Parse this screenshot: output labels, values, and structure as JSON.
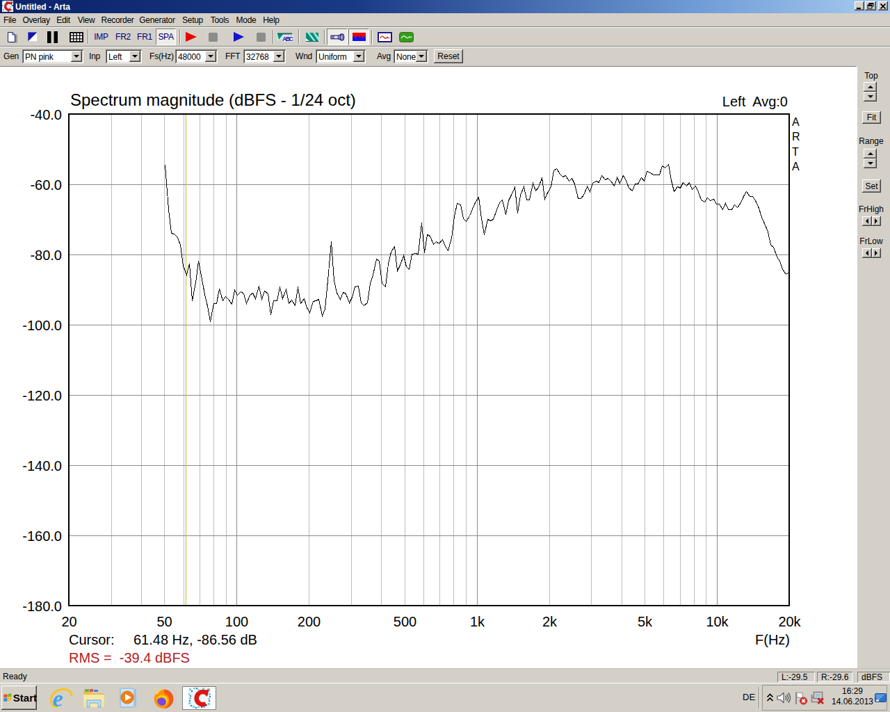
{
  "window": {
    "title": "Untitled - Arta"
  },
  "colors": {
    "titlebar_left": "#0b2369",
    "titlebar_right": "#a8cbf0",
    "ui_face": "#d4d0c8",
    "toolbar_text": "#000080",
    "rms_text": "#b22222"
  },
  "icons": [
    "app-icon",
    "minimize-icon",
    "restore-icon",
    "close-icon",
    "new-file-icon",
    "overlay-icon",
    "pause-icon",
    "table-icon",
    "red-play-icon",
    "stop-icon",
    "blue-play-icon",
    "abc-icon",
    "stripes-icon",
    "microphone-icon",
    "spectrum-icon",
    "sine-wave-icon",
    "green-sine-icon",
    "chevron-down-icon",
    "up-arrow-icon",
    "down-arrow-icon",
    "left-arrow-icon",
    "right-arrow-icon",
    "windows-logo-icon",
    "internet-explorer-icon",
    "file-explorer-icon",
    "media-player-icon",
    "firefox-icon",
    "arta-app-icon",
    "chevron-up-icon",
    "volume-icon",
    "action-center-flag-icon",
    "network-status-icon",
    "show-desktop-icon"
  ],
  "menu": {
    "items": [
      {
        "label": "File",
        "cx": 14
      },
      {
        "label": "Overlay",
        "cx": 52
      },
      {
        "label": "Edit",
        "cx": 91
      },
      {
        "label": "View",
        "cx": 124
      },
      {
        "label": "Recorder",
        "cx": 169
      },
      {
        "label": "Generator",
        "cx": 226
      },
      {
        "label": "Setup",
        "cx": 277
      },
      {
        "label": "Tools",
        "cx": 316
      },
      {
        "label": "Mode",
        "cx": 354
      },
      {
        "label": "Help",
        "cx": 390
      }
    ]
  },
  "toolbar": {
    "imp": "IMP",
    "fr2": "FR2",
    "fr1": "FR1",
    "spa": "SPA"
  },
  "controls": {
    "gen_label": "Gen",
    "gen_value": "PN pink",
    "inp_label": "Inp",
    "inp_value": "Left",
    "fs_label": "Fs(Hz)",
    "fs_value": "48000",
    "fft_label": "FFT",
    "fft_value": "32768",
    "wnd_label": "Wnd",
    "wnd_value": "Uniform",
    "avg_label": "Avg",
    "avg_value": "None",
    "reset_label": "Reset"
  },
  "side_panel": {
    "top_label": "Top",
    "fit_label": "Fit",
    "range_label": "Range",
    "set_label": "Set",
    "frhigh_label": "FrHigh",
    "frlow_label": "FrLow"
  },
  "status": {
    "ready": "Ready",
    "left_level": "L:-29.5",
    "right_level": "R:-29.6",
    "units": "dBFS"
  },
  "taskbar": {
    "start_label": "Start",
    "language": "DE",
    "time": "16:29",
    "date": "14.06.2013"
  },
  "chart_data": {
    "type": "line",
    "title": "Spectrum magnitude (dBFS - 1/24 oct)",
    "channel_label": "Left  Avg:0",
    "xlabel": "F(Hz)",
    "watermark": [
      "A",
      "R",
      "T",
      "A"
    ],
    "xlim": [
      20,
      20000
    ],
    "ylim": [
      -180,
      -40
    ],
    "x_ticks": [
      {
        "f": 20,
        "label": "20"
      },
      {
        "f": 50,
        "label": "50"
      },
      {
        "f": 100,
        "label": "100"
      },
      {
        "f": 200,
        "label": "200"
      },
      {
        "f": 500,
        "label": "500"
      },
      {
        "f": 1000,
        "label": "1k"
      },
      {
        "f": 2000,
        "label": "2k"
      },
      {
        "f": 5000,
        "label": "5k"
      },
      {
        "f": 10000,
        "label": "10k"
      },
      {
        "f": 20000,
        "label": "20k"
      }
    ],
    "y_ticks": [
      {
        "db": -40,
        "label": "-40.0"
      },
      {
        "db": -60,
        "label": "-60.0"
      },
      {
        "db": -80,
        "label": "-80.0"
      },
      {
        "db": -100,
        "label": "-100.0"
      },
      {
        "db": -120,
        "label": "-120.0"
      },
      {
        "db": -140,
        "label": "-140.0"
      },
      {
        "db": -160,
        "label": "-160.0"
      },
      {
        "db": -180,
        "label": "-180.0"
      }
    ],
    "grid_minor": [
      30,
      40,
      50,
      60,
      70,
      80,
      90,
      200,
      300,
      400,
      500,
      600,
      700,
      800,
      900,
      2000,
      3000,
      4000,
      5000,
      6000,
      7000,
      8000,
      9000
    ],
    "grid_major": [
      100,
      1000,
      10000
    ],
    "cursor": {
      "label": "Cursor:",
      "freq": 61.48,
      "db": -86.56,
      "readout": "61.48 Hz, -86.56 dB"
    },
    "rms_text": "RMS =  -39.4 dBFS",
    "colors": {
      "curve": "#000000",
      "grid_major": "#8a8a8a",
      "grid_minor": "#bdbdbd",
      "cursor": "#c8bc32",
      "rms": "#b22222",
      "background": "#ffffff"
    },
    "series": [
      {
        "name": "Left",
        "points": [
          [
            50.3,
            -54.4
          ],
          [
            51.8,
            -67.1
          ],
          [
            53.3,
            -73.86
          ],
          [
            54.9,
            -74.08
          ],
          [
            56.5,
            -75.13
          ],
          [
            58.1,
            -77.27
          ],
          [
            59.8,
            -83.25
          ],
          [
            61.6,
            -85.78
          ],
          [
            63.4,
            -82.63
          ],
          [
            65.2,
            -93.12
          ],
          [
            67.1,
            -87.95
          ],
          [
            69.1,
            -81.79
          ],
          [
            71.1,
            -85.92
          ],
          [
            73.2,
            -91.36
          ],
          [
            75.4,
            -94.69
          ],
          [
            77.6,
            -98.99
          ],
          [
            79.8,
            -93.96
          ],
          [
            82.2,
            -93.8
          ],
          [
            84.6,
            -89.71
          ],
          [
            87.1,
            -93.0
          ],
          [
            89.6,
            -91.84
          ],
          [
            92.3,
            -92.61
          ],
          [
            95.0,
            -94.15
          ],
          [
            97.7,
            -90.07
          ],
          [
            100.6,
            -91.44
          ],
          [
            103.5,
            -90.57
          ],
          [
            106.6,
            -91.04
          ],
          [
            109.7,
            -93.87
          ],
          [
            112.9,
            -91.48
          ],
          [
            116.2,
            -90.85
          ],
          [
            119.6,
            -92.4
          ],
          [
            123.1,
            -88.99
          ],
          [
            126.7,
            -92.69
          ],
          [
            130.5,
            -90.29
          ],
          [
            134.3,
            -91.02
          ],
          [
            138.2,
            -97.03
          ],
          [
            142.3,
            -93.04
          ],
          [
            146.4,
            -92.99
          ],
          [
            150.7,
            -89.19
          ],
          [
            155.1,
            -92.45
          ],
          [
            159.7,
            -89.91
          ],
          [
            164.4,
            -93.87
          ],
          [
            169.2,
            -92.81
          ],
          [
            174.1,
            -94.48
          ],
          [
            179.2,
            -89.05
          ],
          [
            184.5,
            -93.8
          ],
          [
            189.9,
            -92.51
          ],
          [
            195.5,
            -95.12
          ],
          [
            201.2,
            -96.53
          ],
          [
            207.1,
            -93.25
          ],
          [
            213.2,
            -93.07
          ],
          [
            219.4,
            -92.75
          ],
          [
            225.8,
            -97.34
          ],
          [
            232.5,
            -95.46
          ],
          [
            239.3,
            -87.41
          ],
          [
            246.3,
            -76.27
          ],
          [
            253.5,
            -87.36
          ],
          [
            260.9,
            -90.99
          ],
          [
            268.6,
            -92.58
          ],
          [
            276.4,
            -90.63
          ],
          [
            284.5,
            -91.08
          ],
          [
            292.9,
            -93.64
          ],
          [
            301.5,
            -92.06
          ],
          [
            310.3,
            -89.19
          ],
          [
            319.4,
            -88.88
          ],
          [
            328.7,
            -93.65
          ],
          [
            338.4,
            -94.43
          ],
          [
            348.3,
            -93.75
          ],
          [
            358.5,
            -88.06
          ],
          [
            369.0,
            -85.81
          ],
          [
            379.8,
            -81.25
          ],
          [
            390.9,
            -81.73
          ],
          [
            402.4,
            -88.1
          ],
          [
            414.2,
            -89.1
          ],
          [
            426.3,
            -82.59
          ],
          [
            438.8,
            -79.11
          ],
          [
            451.7,
            -77.6
          ],
          [
            464.9,
            -84.61
          ],
          [
            478.5,
            -82.88
          ],
          [
            492.6,
            -80.2
          ],
          [
            507.0,
            -83.34
          ],
          [
            521.8,
            -84.23
          ],
          [
            537.1,
            -79.79
          ],
          [
            552.9,
            -79.53
          ],
          [
            569.1,
            -79.81
          ],
          [
            585.8,
            -70.8
          ],
          [
            602.9,
            -79.41
          ],
          [
            620.6,
            -74.25
          ],
          [
            638.8,
            -74.64
          ],
          [
            657.5,
            -77.09
          ],
          [
            676.8,
            -76.15
          ],
          [
            696.6,
            -76.84
          ],
          [
            717.0,
            -75.71
          ],
          [
            738.0,
            -77.53
          ],
          [
            759.6,
            -78.91
          ],
          [
            781.9,
            -75.21
          ],
          [
            804.8,
            -69.1
          ],
          [
            828.4,
            -65.27
          ],
          [
            852.7,
            -65.65
          ],
          [
            877.6,
            -69.76
          ],
          [
            903.4,
            -70.42
          ],
          [
            929.8,
            -68.89
          ],
          [
            957.1,
            -67.02
          ],
          [
            985.1,
            -65.21
          ],
          [
            1014.0,
            -63.47
          ],
          [
            1043.7,
            -69.61
          ],
          [
            1074.3,
            -74.24
          ],
          [
            1105.8,
            -69.93
          ],
          [
            1138.2,
            -70.32
          ],
          [
            1171.5,
            -69.98
          ],
          [
            1205.8,
            -67.03
          ],
          [
            1241.2,
            -65.22
          ],
          [
            1277.5,
            -64.36
          ],
          [
            1315.0,
            -68.45
          ],
          [
            1353.5,
            -64.52
          ],
          [
            1393.2,
            -62.99
          ],
          [
            1434.0,
            -60.8
          ],
          [
            1476.0,
            -68.06
          ],
          [
            1519.3,
            -62.91
          ],
          [
            1563.8,
            -60.66
          ],
          [
            1609.6,
            -64.39
          ],
          [
            1656.8,
            -64.32
          ],
          [
            1705.3,
            -59.63
          ],
          [
            1755.3,
            -61.81
          ],
          [
            1806.7,
            -60.76
          ],
          [
            1859.7,
            -57.93
          ],
          [
            1914.1,
            -64.14
          ],
          [
            1970.2,
            -62.38
          ],
          [
            2028.0,
            -60.56
          ],
          [
            2087.4,
            -55.96
          ],
          [
            2148.6,
            -55.4
          ],
          [
            2211.5,
            -57.11
          ],
          [
            2276.3,
            -57.76
          ],
          [
            2343.0,
            -57.38
          ],
          [
            2411.7,
            -58.96
          ],
          [
            2482.3,
            -58.16
          ],
          [
            2555.1,
            -59.83
          ],
          [
            2630.0,
            -63.89
          ],
          [
            2707.0,
            -64.02
          ],
          [
            2786.3,
            -63.06
          ],
          [
            2868.0,
            -60.66
          ],
          [
            2952.0,
            -61.93
          ],
          [
            3038.5,
            -59.69
          ],
          [
            3127.6,
            -58.97
          ],
          [
            3219.2,
            -59.37
          ],
          [
            3313.5,
            -57.52
          ],
          [
            3410.6,
            -58.56
          ],
          [
            3510.6,
            -58.15
          ],
          [
            3613.4,
            -59.04
          ],
          [
            3719.3,
            -60.44
          ],
          [
            3828.3,
            -58.05
          ],
          [
            3940.5,
            -59.7
          ],
          [
            4055.9,
            -57.37
          ],
          [
            4174.8,
            -58.8
          ],
          [
            4297.1,
            -60.97
          ],
          [
            4423.0,
            -61.84
          ],
          [
            4552.6,
            -59.71
          ],
          [
            4686.0,
            -59.78
          ],
          [
            4823.4,
            -57.96
          ],
          [
            4964.7,
            -58.93
          ],
          [
            5110.2,
            -56.21
          ],
          [
            5259.9,
            -56.65
          ],
          [
            5414.0,
            -57.14
          ],
          [
            5572.7,
            -57.23
          ],
          [
            5736.0,
            -57.23
          ],
          [
            5904.0,
            -54.56
          ],
          [
            6077.0,
            -55.17
          ],
          [
            6255.1,
            -54.34
          ],
          [
            6438.4,
            -58.77
          ],
          [
            6627.1,
            -62.07
          ],
          [
            6821.2,
            -60.67
          ],
          [
            7021.1,
            -61.03
          ],
          [
            7226.9,
            -59.33
          ],
          [
            7438.6,
            -60.42
          ],
          [
            7656.6,
            -59.48
          ],
          [
            7880.9,
            -61.4
          ],
          [
            8111.9,
            -60.31
          ],
          [
            8349.6,
            -62.26
          ],
          [
            8594.2,
            -64.3
          ],
          [
            8846.1,
            -65.01
          ],
          [
            9105.3,
            -63.79
          ],
          [
            9372.1,
            -64.5
          ],
          [
            9646.7,
            -64.06
          ],
          [
            9929.4,
            -65.54
          ],
          [
            10220.3,
            -65.62
          ],
          [
            10519.8,
            -67.19
          ],
          [
            10828.1,
            -65.36
          ],
          [
            11145.3,
            -67.09
          ],
          [
            11471.9,
            -67.17
          ],
          [
            11808.1,
            -65.77
          ],
          [
            12154.1,
            -66.63
          ],
          [
            12510.2,
            -65.1
          ],
          [
            12876.8,
            -63.28
          ],
          [
            13254.1,
            -61.96
          ],
          [
            13642.5,
            -63.36
          ],
          [
            14042.2,
            -63.34
          ],
          [
            14453.7,
            -64.53
          ],
          [
            14877.2,
            -66.66
          ],
          [
            15313.2,
            -69.31
          ],
          [
            15761.9,
            -71.12
          ],
          [
            16223.8,
            -73.54
          ],
          [
            16699.1,
            -77.25
          ],
          [
            17188.5,
            -77.77
          ],
          [
            17692.1,
            -80.5
          ],
          [
            18210.5,
            -81.71
          ],
          [
            18744.2,
            -84.22
          ],
          [
            19293.4,
            -85.5
          ],
          [
            20000.0,
            -84.9
          ]
        ]
      }
    ]
  }
}
